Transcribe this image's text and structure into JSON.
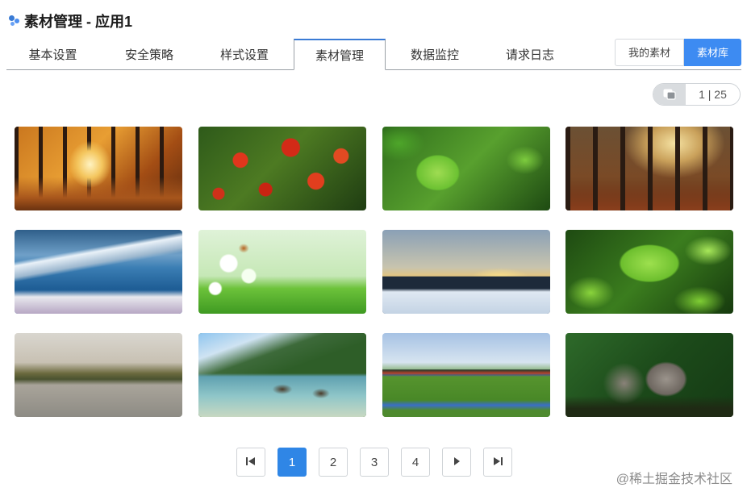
{
  "header": {
    "title": "素材管理 - 应用1"
  },
  "tabs": [
    {
      "label": "基本设置",
      "active": false
    },
    {
      "label": "安全策略",
      "active": false
    },
    {
      "label": "样式设置",
      "active": false
    },
    {
      "label": "素材管理",
      "active": true
    },
    {
      "label": "数据监控",
      "active": false
    },
    {
      "label": "请求日志",
      "active": false
    }
  ],
  "toggle": {
    "mine_label": "我的素材",
    "library_label": "素材库",
    "selected": "素材库",
    "accent": "#3d8bf2"
  },
  "page_indicator": {
    "text": "1 | 25",
    "icon": "copy-icon"
  },
  "images": [
    {
      "name": "autumn-forest-path"
    },
    {
      "name": "red-maple-leaves"
    },
    {
      "name": "green-heart-leaf"
    },
    {
      "name": "forest-sunbeams"
    },
    {
      "name": "snowy-mountain-lake"
    },
    {
      "name": "dandelions-butterfly"
    },
    {
      "name": "winter-house-sunset"
    },
    {
      "name": "water-drop-leaves"
    },
    {
      "name": "misty-lake-reflection"
    },
    {
      "name": "ducks-mountain-lake"
    },
    {
      "name": "windmills-green-field"
    },
    {
      "name": "squirrel"
    }
  ],
  "pagination": {
    "first_icon": "first-page-icon",
    "pages": [
      "1",
      "2",
      "3",
      "4"
    ],
    "current": "1",
    "next_icon": "next-page-icon",
    "last_icon": "last-page-icon",
    "accent": "#2f86e6"
  },
  "watermark": "@稀土掘金技术社区"
}
